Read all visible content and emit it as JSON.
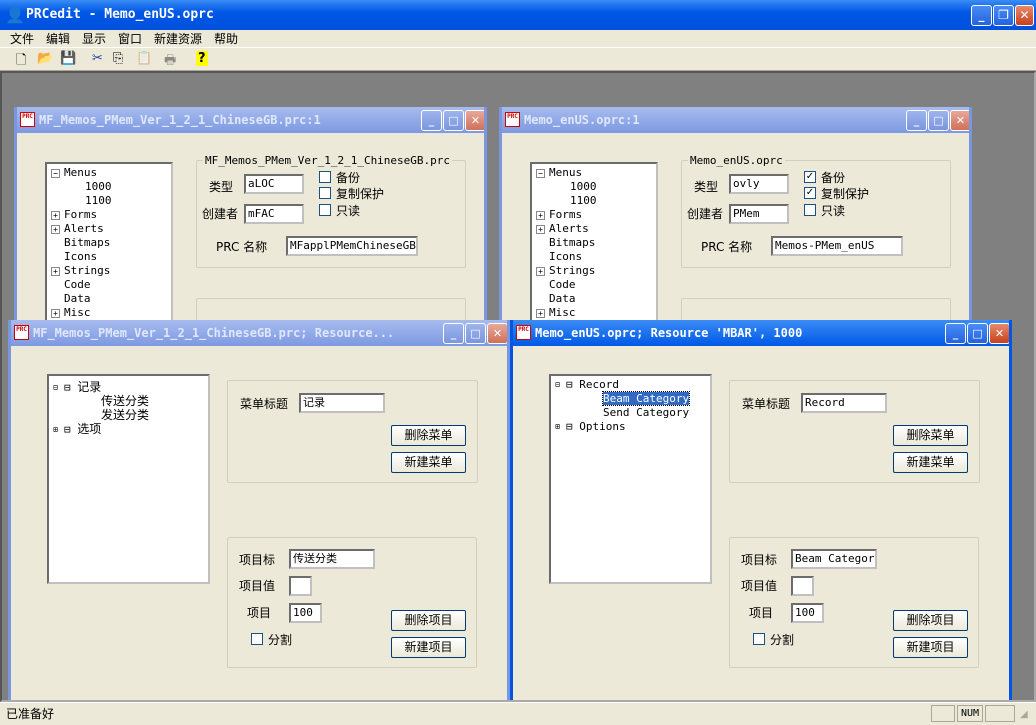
{
  "app": {
    "title": "PRCedit - Memo_enUS.oprc",
    "icon": "user-icon"
  },
  "menu": [
    "文件",
    "编辑",
    "显示",
    "窗口",
    "新建资源",
    "帮助"
  ],
  "toolbar": [
    {
      "icon": "new-icon",
      "g": "🗋"
    },
    {
      "icon": "open-icon",
      "g": "📂"
    },
    {
      "icon": "save-icon",
      "g": "💾"
    },
    {
      "icon": "cut-icon",
      "g": "✂"
    },
    {
      "icon": "copy-icon",
      "g": "⎘"
    },
    {
      "icon": "paste-icon",
      "g": "📋"
    },
    {
      "icon": "print-icon",
      "g": "🖶"
    },
    {
      "icon": "help-icon",
      "g": "?"
    }
  ],
  "status": {
    "text": "已准备好",
    "num": "NUM"
  },
  "winA": {
    "title": "MF_Memos_PMem_Ver_1_2_1_ChineseGB.prc:1",
    "tree": [
      "Menus",
      "1000",
      "1100",
      "Forms",
      "Alerts",
      "Bitmaps",
      "Icons",
      "Strings",
      "Code",
      "Data",
      "Misc"
    ],
    "group": "MF_Memos_PMem_Ver_1_2_1_ChineseGB.prc",
    "type_label": "类型",
    "type": "aLOC",
    "creator_label": "创建者",
    "creator": "mFAC",
    "backup": "备份",
    "copyprot": "复制保护",
    "readonly": "只读",
    "name_label": "PRC 名称",
    "name": "MFapplPMemChineseGB",
    "backup_checked": false,
    "copyprot_checked": false,
    "readonly_checked": false
  },
  "winB": {
    "title": "Memo_enUS.oprc:1",
    "tree": [
      "Menus",
      "1000",
      "1100",
      "Forms",
      "Alerts",
      "Bitmaps",
      "Icons",
      "Strings",
      "Code",
      "Data",
      "Misc"
    ],
    "group": "Memo_enUS.oprc",
    "type_label": "类型",
    "type": "ovly",
    "creator_label": "创建者",
    "creator": "PMem",
    "backup": "备份",
    "copyprot": "复制保护",
    "readonly": "只读",
    "name_label": "PRC 名称",
    "name": "Memos-PMem_enUS",
    "backup_checked": true,
    "copyprot_checked": true,
    "readonly_checked": false
  },
  "winC": {
    "title": "MF_Memos_PMem_Ver_1_2_1_ChineseGB.prc; Resource...",
    "tree": [
      "记录",
      "传送分类",
      "发送分类",
      "选项"
    ],
    "menu_title_label": "菜单标题",
    "menu_title": "记录",
    "del_menu": "删除菜单",
    "new_menu": "新建菜单",
    "item_label_label": "项目标",
    "item_label": "传送分类",
    "item_value_label": "项目值",
    "item_value": "",
    "item_label2": "项目",
    "item_id": "100",
    "split": "分割",
    "del_item": "删除项目",
    "new_item": "新建项目"
  },
  "winD": {
    "title": "Memo_enUS.oprc; Resource 'MBAR', 1000",
    "tree": [
      "Record",
      "Beam Category",
      "Send Category",
      "Options"
    ],
    "menu_title_label": "菜单标题",
    "menu_title": "Record",
    "del_menu": "删除菜单",
    "new_menu": "新建菜单",
    "item_label_label": "项目标",
    "item_label": "Beam Category",
    "item_value_label": "项目值",
    "item_value": "",
    "item_label2": "项目",
    "item_id": "100",
    "split": "分割",
    "del_item": "删除项目",
    "new_item": "新建项目"
  }
}
